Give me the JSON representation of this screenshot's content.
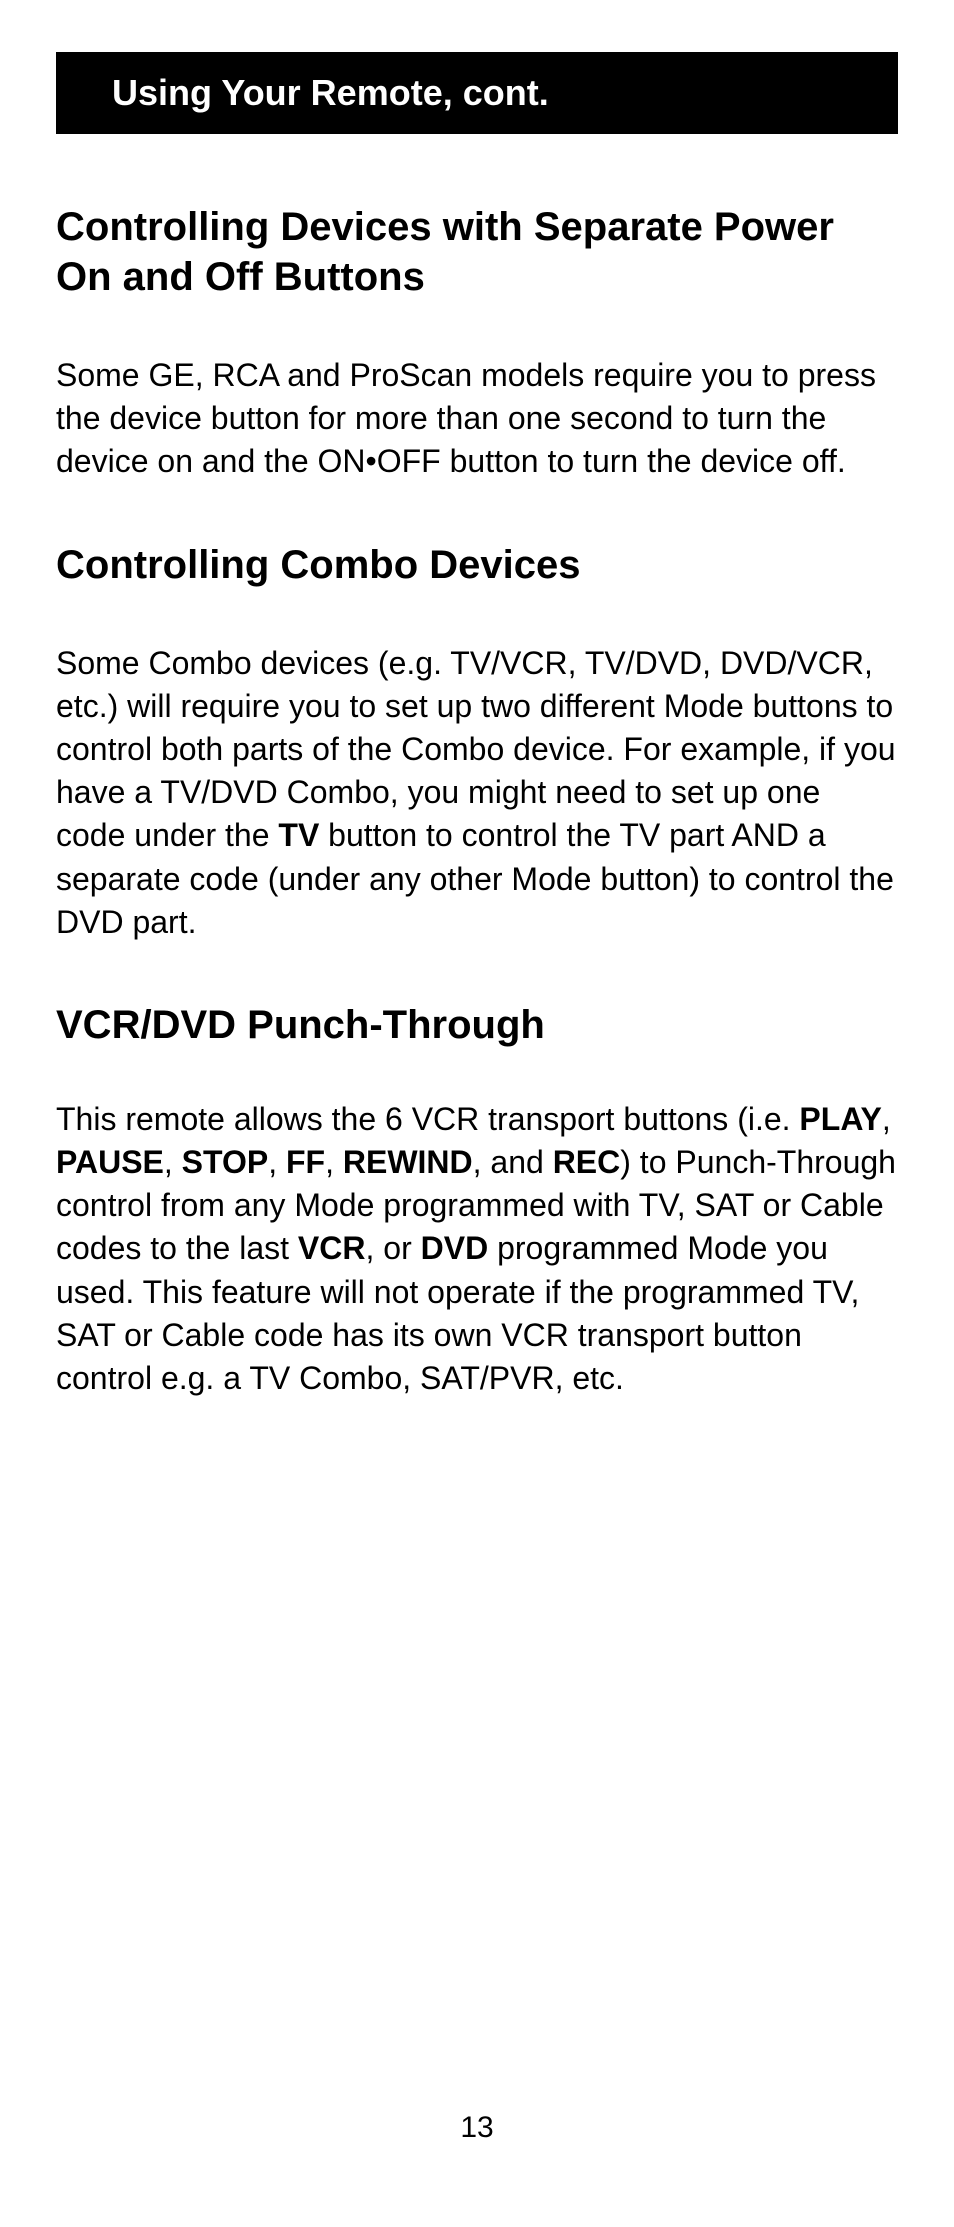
{
  "header": {
    "title": "Using Your Remote, cont."
  },
  "sections": [
    {
      "heading": "Controlling Devices with Separate Power On and Off Buttons",
      "body_parts": [
        {
          "text": "Some GE, RCA and ProScan models require you to press the device button for more than one second to turn the device on and the ON•OFF button to turn the device off.",
          "bold": false
        }
      ]
    },
    {
      "heading": "Controlling Combo Devices",
      "body_parts": [
        {
          "text": "Some Combo devices (e.g. TV/VCR, TV/DVD, DVD/VCR, etc.) will require you to set up two different Mode buttons to control both parts of the Combo device. For example, if you have a TV/DVD Combo, you might need to set up one code under the ",
          "bold": false
        },
        {
          "text": "TV",
          "bold": true
        },
        {
          "text": " button to control the TV part AND a separate code (under any other Mode button) to control the DVD part.",
          "bold": false
        }
      ]
    },
    {
      "heading": "VCR/DVD Punch-Through",
      "body_parts": [
        {
          "text": "This remote allows the 6 VCR transport buttons (i.e. ",
          "bold": false
        },
        {
          "text": "PLAY",
          "bold": true
        },
        {
          "text": ", ",
          "bold": false
        },
        {
          "text": "PAUSE",
          "bold": true
        },
        {
          "text": ", ",
          "bold": false
        },
        {
          "text": "STOP",
          "bold": true
        },
        {
          "text": ", ",
          "bold": false
        },
        {
          "text": "FF",
          "bold": true
        },
        {
          "text": ", ",
          "bold": false
        },
        {
          "text": "REWIND",
          "bold": true
        },
        {
          "text": ", and ",
          "bold": false
        },
        {
          "text": "REC",
          "bold": true
        },
        {
          "text": ") to Punch-Through control from any Mode programmed with TV, SAT or Cable codes to the last ",
          "bold": false
        },
        {
          "text": "VCR",
          "bold": true
        },
        {
          "text": ", or ",
          "bold": false
        },
        {
          "text": "DVD",
          "bold": true
        },
        {
          "text": " programmed Mode you used. This feature will not operate if the programmed TV, SAT or Cable code has its own VCR transport button control e.g. a TV Combo, SAT/PVR, etc.",
          "bold": false
        }
      ]
    }
  ],
  "page_number": "13"
}
